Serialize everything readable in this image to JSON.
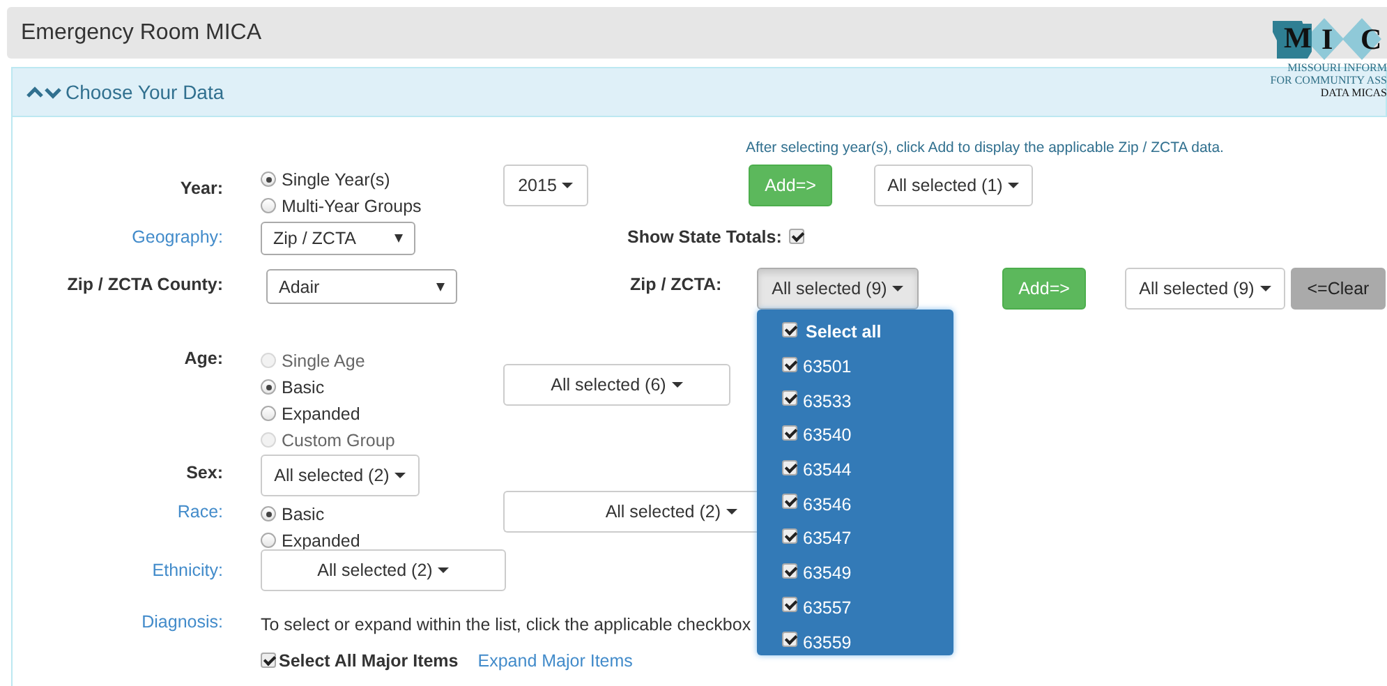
{
  "header": {
    "title": "Emergency Room MICA",
    "logo": {
      "letters": [
        "M",
        "I",
        "C"
      ],
      "lines": [
        "MISSOURI INFORM",
        "FOR COMMUNITY ASS",
        "DATA MICAS"
      ]
    }
  },
  "panel": {
    "title": "Choose Your Data"
  },
  "note": "After selecting year(s), click Add to display the applicable Zip / ZCTA data.",
  "year": {
    "label": "Year:",
    "label_link": false,
    "options": [
      {
        "label": "Single Year(s)",
        "selected": true,
        "disabled": false
      },
      {
        "label": "Multi-Year Groups",
        "selected": false,
        "disabled": false
      }
    ],
    "year_button": "2015",
    "add_button": "Add=>",
    "selection": "All selected (1)"
  },
  "geography": {
    "label": "Geography:",
    "label_link": true,
    "value": "Zip / ZCTA",
    "show_state_totals": {
      "label": "Show State Totals:",
      "checked": true
    }
  },
  "zcta_county": {
    "label": "Zip / ZCTA County:",
    "label_link": false,
    "value": "Adair"
  },
  "zcta": {
    "label": "Zip / ZCTA:",
    "label_link": false,
    "dropdown_button": "All selected (9)",
    "expanded": true,
    "items": [
      {
        "label": "Select all",
        "checked": true,
        "kind": "select_all"
      },
      {
        "label": "63501",
        "checked": true,
        "kind": "item"
      },
      {
        "label": "63533",
        "checked": true,
        "kind": "item"
      },
      {
        "label": "63540",
        "checked": true,
        "kind": "item"
      },
      {
        "label": "63544",
        "checked": true,
        "kind": "item"
      },
      {
        "label": "63546",
        "checked": true,
        "kind": "item"
      },
      {
        "label": "63547",
        "checked": true,
        "kind": "item"
      },
      {
        "label": "63549",
        "checked": true,
        "kind": "item"
      },
      {
        "label": "63557",
        "checked": true,
        "kind": "item"
      },
      {
        "label": "63559",
        "checked": true,
        "kind": "item"
      }
    ],
    "add_button": "Add=>",
    "selection": "All selected (9)",
    "clear_button": "<=Clear"
  },
  "age": {
    "label": "Age:",
    "label_link": false,
    "options": [
      {
        "label": "Single Age",
        "selected": false,
        "disabled": true
      },
      {
        "label": "Basic",
        "selected": true,
        "disabled": false
      },
      {
        "label": "Expanded",
        "selected": false,
        "disabled": false
      },
      {
        "label": "Custom Group",
        "selected": false,
        "disabled": true
      }
    ],
    "selection": "All selected (6)"
  },
  "sex": {
    "label": "Sex:",
    "label_link": false,
    "selection": "All selected (2)"
  },
  "race": {
    "label": "Race:",
    "label_link": true,
    "options": [
      {
        "label": "Basic",
        "selected": true,
        "disabled": false
      },
      {
        "label": "Expanded",
        "selected": false,
        "disabled": false
      }
    ],
    "selection": "All selected (2)"
  },
  "ethnicity": {
    "label": "Ethnicity:",
    "label_link": true,
    "selection": "All selected (2)"
  },
  "diagnosis": {
    "label": "Diagnosis:",
    "label_link": true,
    "instructions": "To select or expand within the list, click the applicable checkbox",
    "select_all": {
      "label": "Select All Major Items",
      "checked": true
    },
    "expand_link": "Expand Major Items"
  }
}
